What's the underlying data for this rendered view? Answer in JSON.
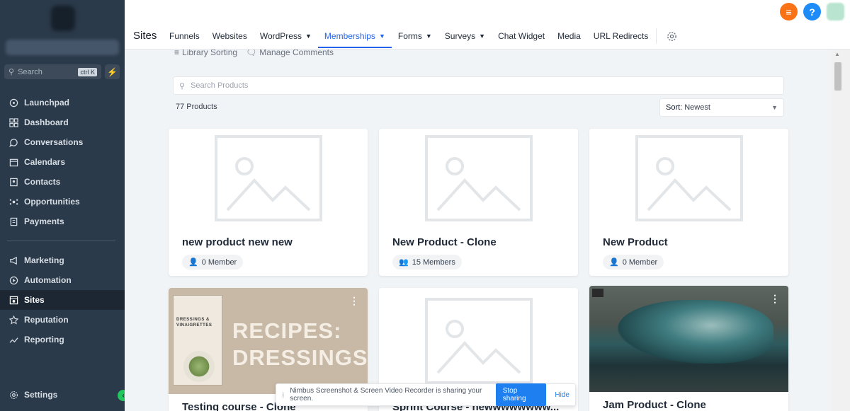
{
  "sidebar": {
    "search_placeholder": "Search",
    "search_shortcut": "ctrl K",
    "items_top": [
      {
        "label": "Launchpad",
        "icon": "rocket-icon"
      },
      {
        "label": "Dashboard",
        "icon": "dashboard-icon"
      },
      {
        "label": "Conversations",
        "icon": "chat-icon"
      },
      {
        "label": "Calendars",
        "icon": "calendar-icon"
      },
      {
        "label": "Contacts",
        "icon": "contacts-icon"
      },
      {
        "label": "Opportunities",
        "icon": "opportunities-icon"
      },
      {
        "label": "Payments",
        "icon": "payments-icon"
      }
    ],
    "items_bottom": [
      {
        "label": "Marketing",
        "icon": "megaphone-icon"
      },
      {
        "label": "Automation",
        "icon": "automation-icon"
      },
      {
        "label": "Sites",
        "icon": "sites-icon"
      },
      {
        "label": "Reputation",
        "icon": "star-icon"
      },
      {
        "label": "Reporting",
        "icon": "chart-icon"
      }
    ],
    "settings_label": "Settings",
    "active_item": "Sites"
  },
  "header": {
    "title": "Sites",
    "nav": [
      {
        "label": "Funnels"
      },
      {
        "label": "Websites"
      },
      {
        "label": "WordPress",
        "dropdown": true
      },
      {
        "label": "Memberships",
        "dropdown": true,
        "active": true
      },
      {
        "label": "Forms",
        "dropdown": true
      },
      {
        "label": "Surveys",
        "dropdown": true
      },
      {
        "label": "Chat Widget"
      },
      {
        "label": "Media"
      },
      {
        "label": "URL Redirects"
      }
    ]
  },
  "content": {
    "actions": {
      "library_sorting": "Library Sorting",
      "manage_comments": "Manage Comments"
    },
    "search_placeholder": "Search Products",
    "product_count": "77 Products",
    "sort_label": "Sort:",
    "sort_value": "Newest",
    "products": [
      {
        "title": "new product new new",
        "members": "0 Member"
      },
      {
        "title": "New Product - Clone",
        "members": "15 Members"
      },
      {
        "title": "New Product",
        "members": "0 Member"
      },
      {
        "title": "Testing course - Clone",
        "image": "recipes"
      },
      {
        "title": "Sprint Course - newwwwwwww..."
      },
      {
        "title": "Jam Product - Clone",
        "image": "wave"
      }
    ],
    "recipe_text": "RECIPES:\nDRESSINGS+",
    "recipe_book_title": "DRESSINGS &\nVINAIGRETTES"
  },
  "share_banner": {
    "message": "Nimbus Screenshot & Screen Video Recorder is sharing your screen.",
    "stop_label": "Stop sharing",
    "hide_label": "Hide"
  },
  "colors": {
    "accent": "#2563eb",
    "sidebar_bg": "#2b3a4a",
    "stop_button": "#1d7ff0"
  }
}
